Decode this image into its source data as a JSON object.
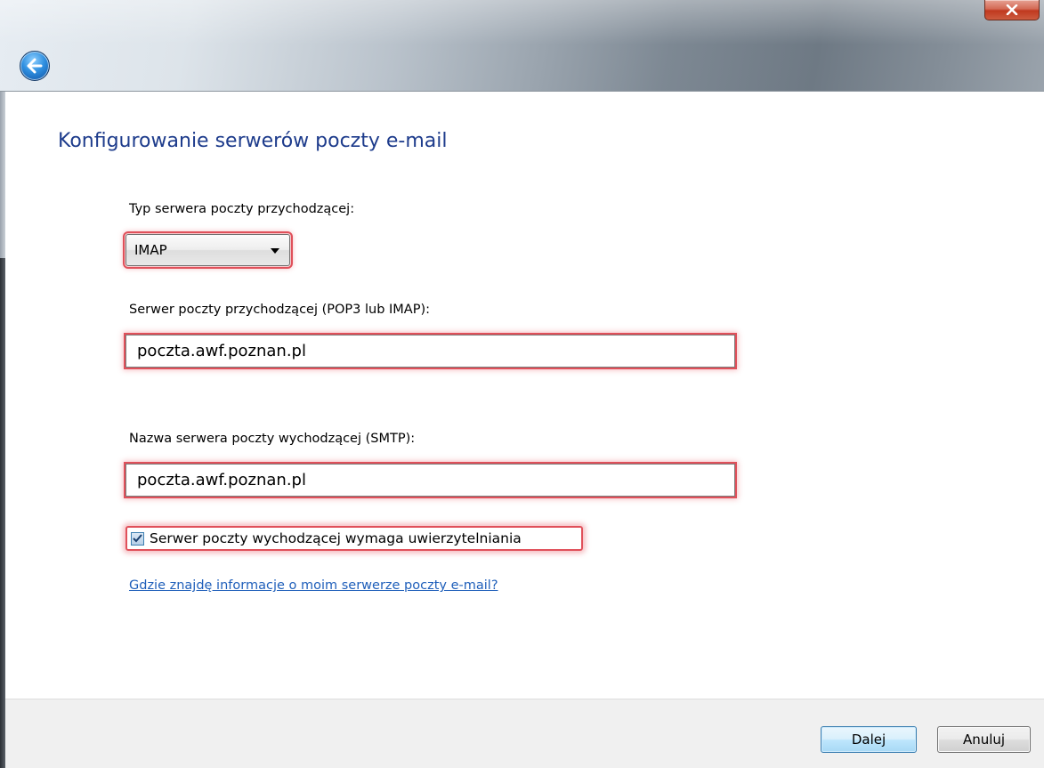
{
  "window": {
    "close_label": "x"
  },
  "heading": "Konfigurowanie serwerów poczty e-mail",
  "incoming_type": {
    "label": "Typ serwera poczty przychodzącej:",
    "selected": "IMAP"
  },
  "incoming_server": {
    "label": "Serwer poczty przychodzącej (POP3 lub IMAP):",
    "value": "poczta.awf.poznan.pl"
  },
  "outgoing_server": {
    "label": "Nazwa serwera poczty wychodzącej (SMTP):",
    "value": "poczta.awf.poznan.pl"
  },
  "auth_checkbox": {
    "label": "Serwer poczty wychodzącej wymaga uwierzytelniania",
    "checked": true
  },
  "help_link": "Gdzie znajdę informacje o moim serwerze poczty e-mail?",
  "buttons": {
    "next": "Dalej",
    "cancel": "Anuluj"
  },
  "colors": {
    "heading": "#1e3c8c",
    "link": "#1f5fba",
    "highlight": "#e0505a"
  },
  "icons": {
    "back": "back-arrow-icon",
    "close": "close-icon",
    "check": "checkmark-icon"
  }
}
